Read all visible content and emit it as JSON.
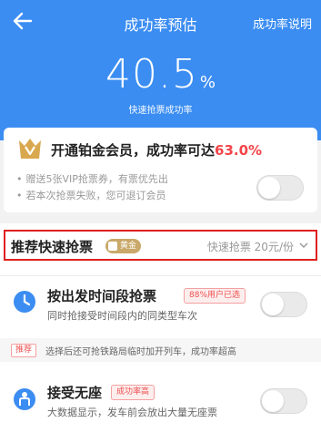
{
  "header": {
    "title": "成功率预估",
    "explain_link": "成功率说明",
    "background_color": "#3b8df2"
  },
  "rate": {
    "value": "40.5",
    "unit": "%",
    "caption": "快速抢票成功率"
  },
  "vip": {
    "title_prefix": "开通铂金会员，成功率可达",
    "title_rate": "63.0%",
    "bullets": [
      "赠送5张VIP抢票券，有票优先出",
      "若本次抢票失败，您可退订会员"
    ],
    "toggle_on": false
  },
  "fast_grab": {
    "title": "推荐快速抢票",
    "badge": "黄金",
    "price": "快速抢票 20元/份"
  },
  "features": [
    {
      "icon": "clock-icon",
      "title": "按出发时间段抢票",
      "tag": "88%用户已选",
      "subtitle": "同时抢接受时间段内的同类型车次",
      "toggle_on": false
    },
    {
      "icon": "person-seat-icon",
      "title": "接受无座",
      "tag": "成功率高",
      "subtitle": "大数据显示，发车前会放出大量无座票",
      "toggle_on": false
    }
  ],
  "tip": {
    "tag": "推荐",
    "text": "选择后还可抢铁路局临时加开列车，成功率超高"
  },
  "colors": {
    "accent_red": "#f2454a",
    "highlight_border": "#e02020",
    "gold": "#c9a86a"
  }
}
